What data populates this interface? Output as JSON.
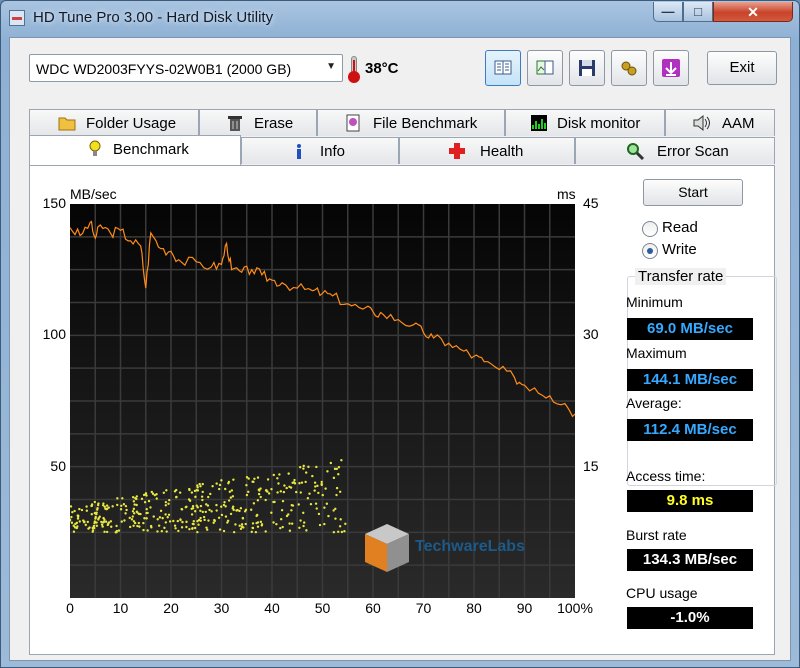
{
  "window": {
    "title": "HD Tune Pro 3.00 - Hard Disk Utility"
  },
  "toolbar": {
    "drive": "WDC WD2003FYYS-02W0B1 (2000 GB)",
    "temperature": "38°C",
    "exit_label": "Exit"
  },
  "tabs_top": [
    "Folder Usage",
    "Erase",
    "File Benchmark",
    "Disk monitor",
    "AAM"
  ],
  "tabs_bottom": [
    "Benchmark",
    "Info",
    "Health",
    "Error Scan"
  ],
  "active_tab": "Benchmark",
  "controls": {
    "start_label": "Start",
    "mode_options": [
      "Read",
      "Write"
    ],
    "mode_selected": "Write"
  },
  "results": {
    "transfer_rate_title": "Transfer rate",
    "minimum_label": "Minimum",
    "minimum_value": "69.0 MB/sec",
    "maximum_label": "Maximum",
    "maximum_value": "144.1 MB/sec",
    "average_label": "Average:",
    "average_value": "112.4 MB/sec",
    "access_label": "Access time:",
    "access_value": "9.8 ms",
    "burst_label": "Burst rate",
    "burst_value": "134.3 MB/sec",
    "cpu_label": "CPU usage",
    "cpu_value": "-1.0%"
  },
  "watermark": {
    "text": "TechwareLabs"
  },
  "colors": {
    "transfer_line": "#ff8c1a",
    "access_dots": "#e8e840",
    "chart_bg": "#000000",
    "grid": "#3a3a3a"
  },
  "chart_data": {
    "type": "line",
    "title": "",
    "xlabel": "",
    "y_left_unit": "MB/sec",
    "y_right_unit": "ms",
    "xlim": [
      0,
      100
    ],
    "ylim_left": [
      0,
      150
    ],
    "ylim_right": [
      0,
      45
    ],
    "x_ticks": [
      "0",
      "10",
      "20",
      "30",
      "40",
      "50",
      "60",
      "70",
      "80",
      "90",
      "100%"
    ],
    "y_left_ticks": [
      "50",
      "100",
      "150"
    ],
    "y_right_ticks": [
      "15",
      "30",
      "45"
    ],
    "series": [
      {
        "kind": "line",
        "axis": "left",
        "x": [
          0,
          2,
          4,
          5,
          6,
          8,
          10,
          12,
          14,
          15,
          16,
          18,
          20,
          22,
          25,
          28,
          30,
          31,
          32,
          34,
          36,
          38,
          40,
          42,
          45,
          48,
          50,
          52,
          55,
          58,
          60,
          62,
          65,
          68,
          70,
          72,
          75,
          78,
          80,
          82,
          85,
          88,
          90,
          92,
          95,
          98,
          100
        ],
        "y": [
          141,
          138,
          143,
          137,
          142,
          139,
          140,
          136,
          134,
          118,
          139,
          133,
          132,
          128,
          128,
          126,
          127,
          135,
          125,
          124,
          125,
          123,
          121,
          120,
          118,
          117,
          116,
          115,
          112,
          110,
          109,
          108,
          106,
          104,
          101,
          99,
          97,
          94,
          92,
          90,
          87,
          84,
          81,
          80,
          77,
          74,
          70
        ]
      },
      {
        "kind": "scatter",
        "axis": "right",
        "description_x_range": [
          0,
          55
        ],
        "description_y_range": [
          6,
          17
        ]
      }
    ]
  }
}
